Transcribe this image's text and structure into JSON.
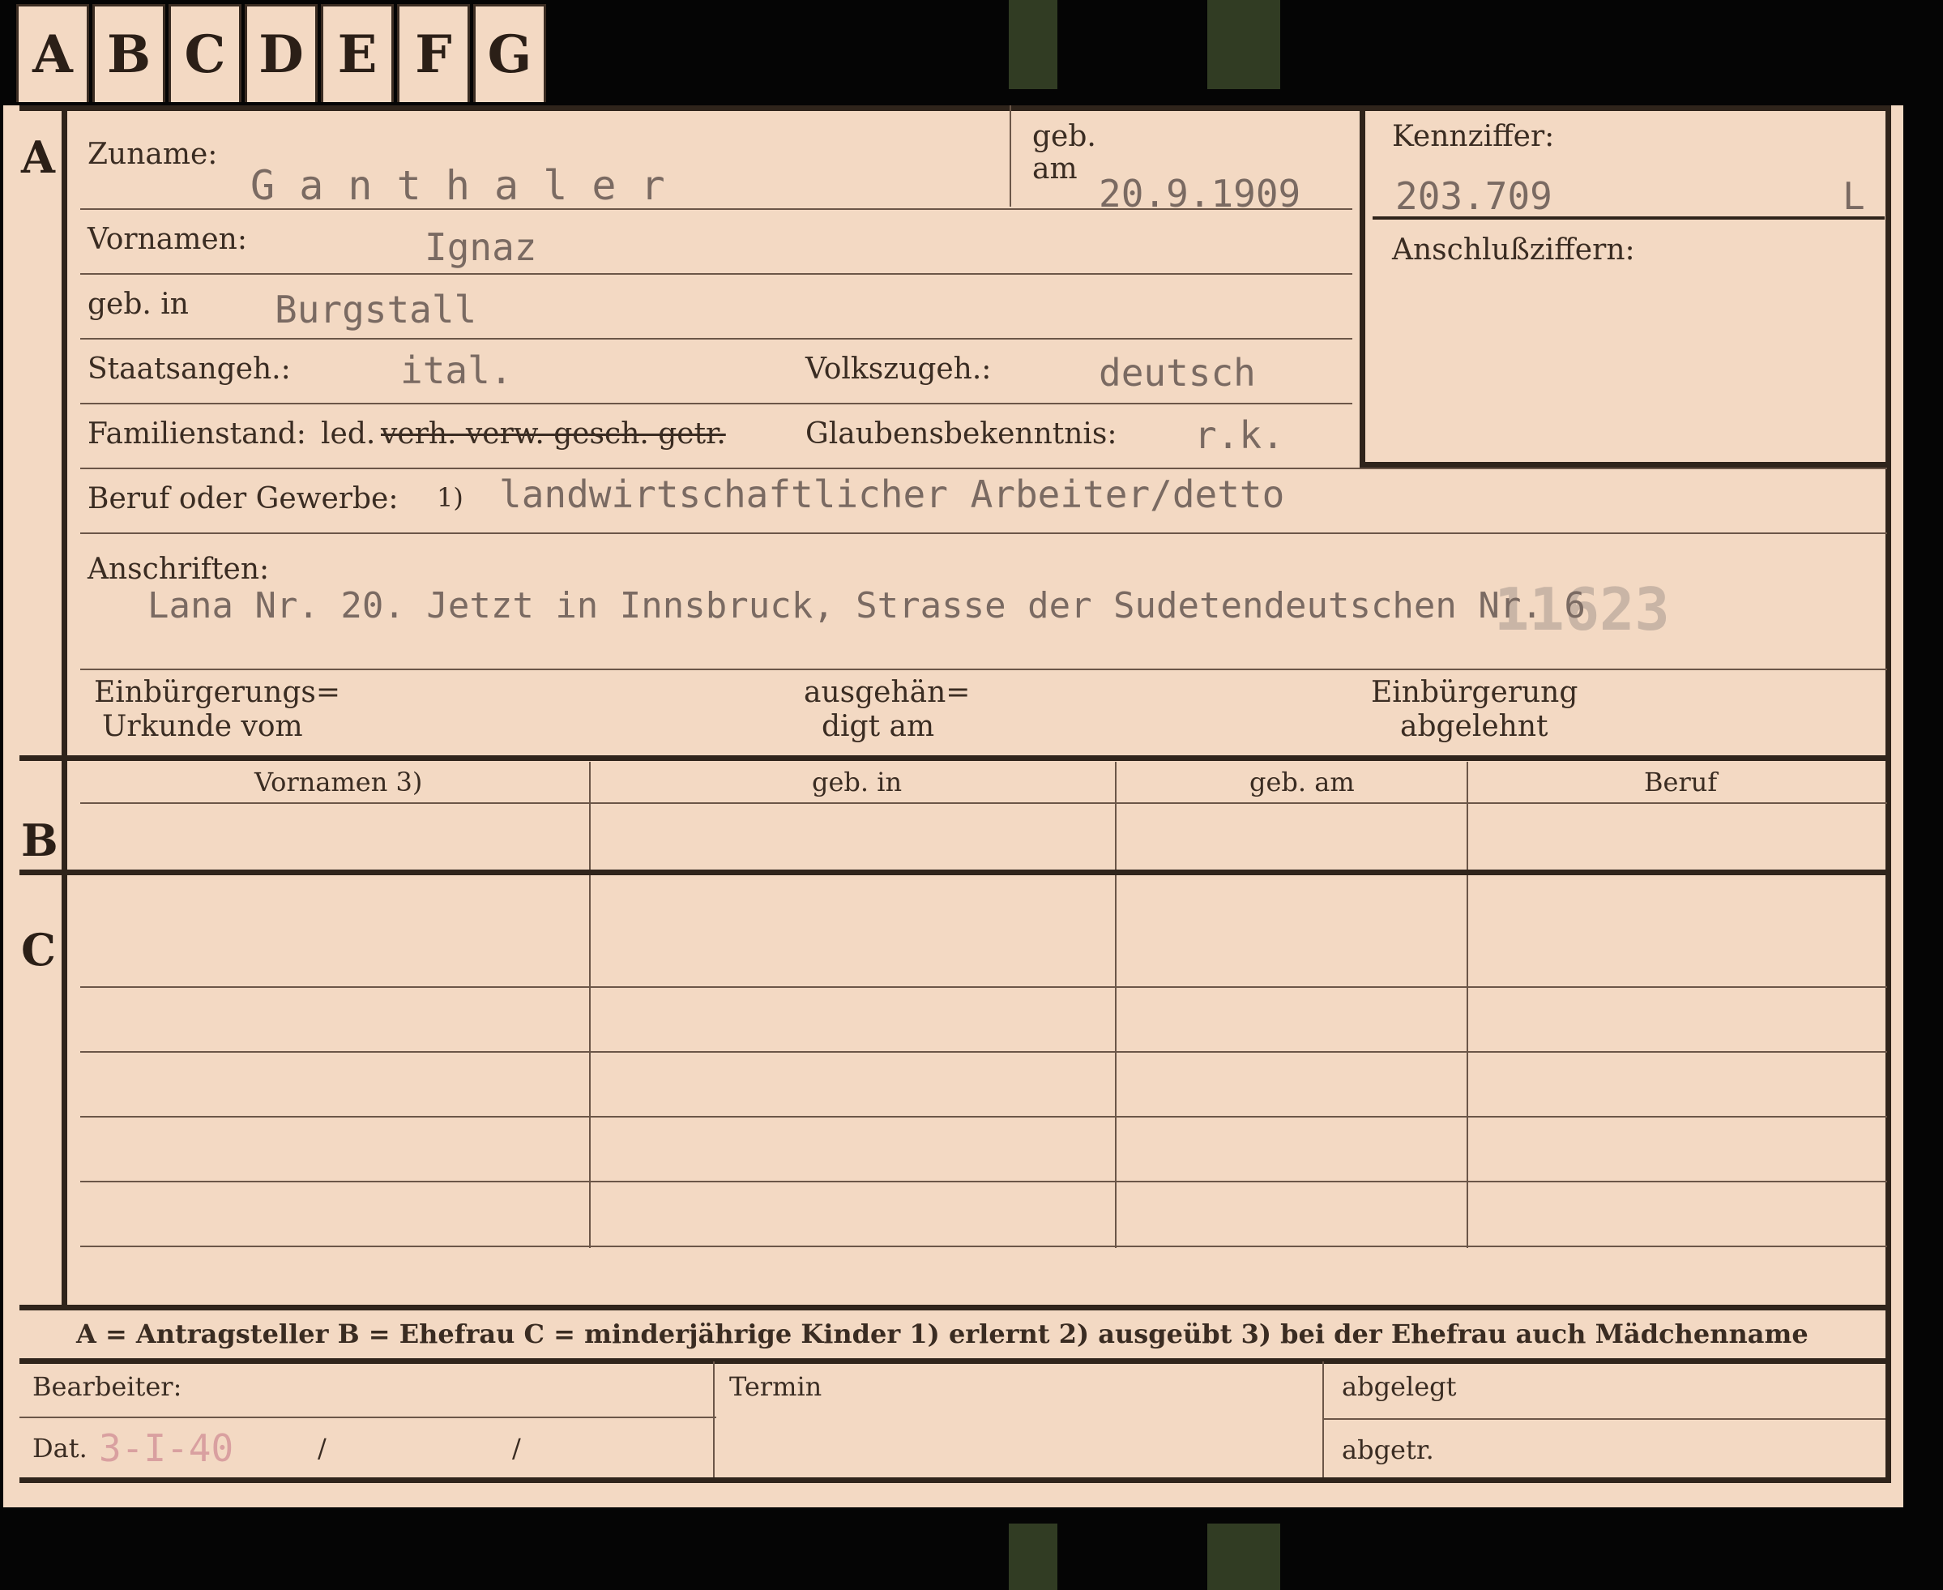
{
  "tabs": [
    "A",
    "B",
    "C",
    "D",
    "E",
    "F",
    "G"
  ],
  "sections": {
    "a": "A",
    "b": "B",
    "c": "C"
  },
  "fields": {
    "zuname_label": "Zuname:",
    "zuname_value": "G a n t h a l e r",
    "geb_label_1": "geb.",
    "geb_label_2": "am",
    "geb_am_value": "20.9.1909",
    "vornamen_label": "Vornamen:",
    "vornamen_value": "Ignaz",
    "geb_in_label": "geb. in",
    "geb_in_value": "Burgstall",
    "staatsangeh_label": "Staatsangeh.:",
    "staatsangeh_value": "ital.",
    "volkszugeh_label": "Volkszugeh.:",
    "volkszugeh_value": "deutsch",
    "familienstand_label": "Familienstand:",
    "familienstand_led": "led.",
    "familienstand_struck": "verh. verw. gesch. getr.",
    "glaubens_label": "Glaubensbekenntnis:",
    "glaubens_value": "r.k.",
    "beruf_label": "Beruf oder Gewerbe:",
    "beruf_footnote": "1)",
    "beruf_value": "landwirtschaftlicher Arbeiter/detto",
    "anschriften_label": "Anschriften:",
    "anschriften_value": "Lana Nr. 20. Jetzt in Innsbruck, Strasse der Sudetendeutschen Nr. 6",
    "stamp_number": "11623",
    "einb_urk_1": "Einbürgerungs=",
    "einb_urk_2": "Urkunde vom",
    "ausgeh_1": "ausgehän=",
    "ausgeh_2": "digt am",
    "einb_abg_1": "Einbürgerung",
    "einb_abg_2": "abgelehnt"
  },
  "kennziffer": {
    "label": "Kennziffer:",
    "value": "203.709",
    "suffix": "L",
    "anschluss_label": "Anschlußziffern:"
  },
  "table": {
    "headers": [
      "Vornamen 3)",
      "geb. in",
      "geb. am",
      "Beruf"
    ]
  },
  "legend": "A = Antragsteller   B = Ehefrau   C = minderjährige Kinder   1) erlernt   2) ausgeübt   3) bei der Ehefrau auch Mädchenname",
  "footer": {
    "bearbeiter_label": "Bearbeiter:",
    "dat_label": "Dat.",
    "dat_value": "3-I-40",
    "dat_sep1": "/",
    "dat_sep2": "/",
    "termin_label": "Termin",
    "abgelegt_label": "abgelegt",
    "abgetr_label": "abgetr."
  }
}
